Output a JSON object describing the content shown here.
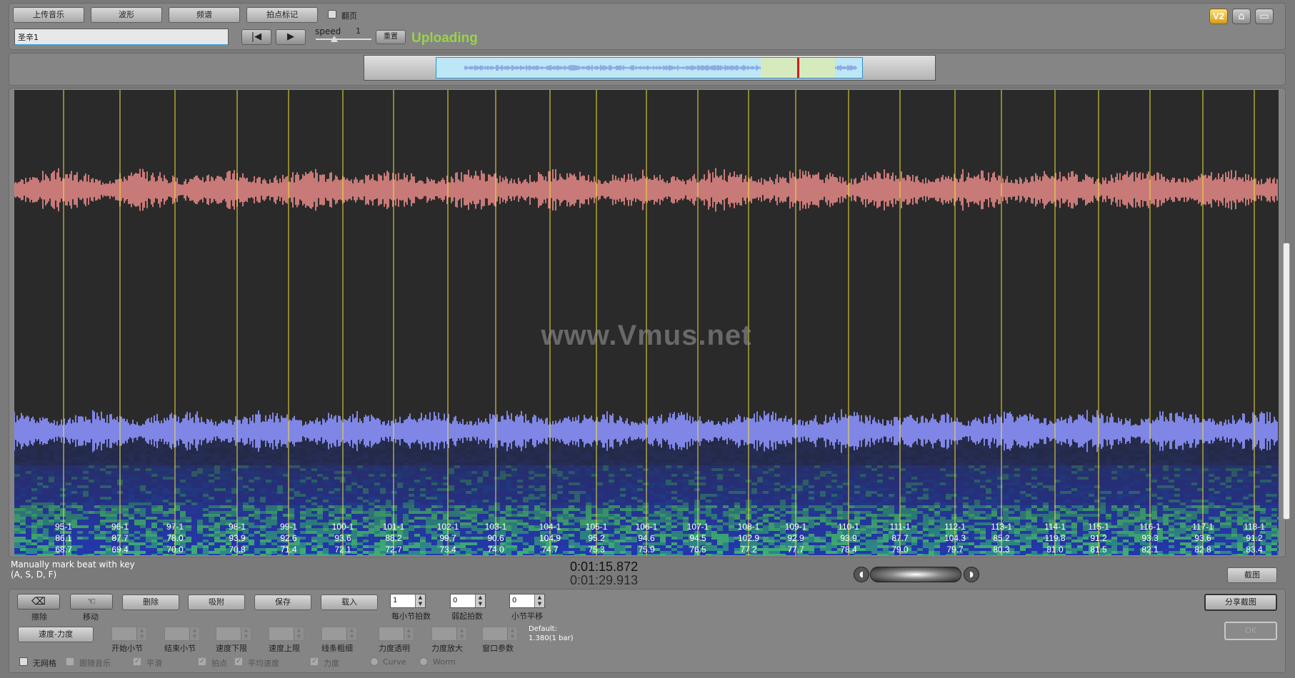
{
  "toolbar": {
    "upload_music": "上传音乐",
    "waveform": "波形",
    "spectrum": "频谱",
    "beat_mark": "拍点标记",
    "flip_page": "翻页",
    "song_name": "圣辛1",
    "speed_label": "speed",
    "speed_value": "1",
    "reset": "重置",
    "status": "Uploading"
  },
  "overview": {
    "window_color": "#bde7f7",
    "selection_color": "#d6ebbd",
    "cursor_color": "#d21a1a"
  },
  "display": {
    "watermark": "www.Vmus.net",
    "wave_top_color": "#c87a78",
    "wave_bottom_color": "#7f86e6",
    "beat_line_color": "#f3e23a",
    "beats": [
      {
        "bar": "95-1",
        "tempo": "86.1",
        "t": "68.7"
      },
      {
        "bar": "96-1",
        "tempo": "87.7",
        "t": "69.4"
      },
      {
        "bar": "97-1",
        "tempo": "78.0",
        "t": "70.0"
      },
      {
        "bar": "98-1",
        "tempo": "93.9",
        "t": "70.8"
      },
      {
        "bar": "99-1",
        "tempo": "92.6",
        "t": "71.4"
      },
      {
        "bar": "100-1",
        "tempo": "93.6",
        "t": "72.1"
      },
      {
        "bar": "101-1",
        "tempo": "88.2",
        "t": "72.7"
      },
      {
        "bar": "102-1",
        "tempo": "99.7",
        "t": "73.4"
      },
      {
        "bar": "103-1",
        "tempo": "90.6",
        "t": "74.0"
      },
      {
        "bar": "104-1",
        "tempo": "104.9",
        "t": "74.7"
      },
      {
        "bar": "105-1",
        "tempo": "95.2",
        "t": "75.3"
      },
      {
        "bar": "106-1",
        "tempo": "94.6",
        "t": "75.9"
      },
      {
        "bar": "107-1",
        "tempo": "94.5",
        "t": "76.5"
      },
      {
        "bar": "108-1",
        "tempo": "102.9",
        "t": "77.2"
      },
      {
        "bar": "109-1",
        "tempo": "92.9",
        "t": "77.7"
      },
      {
        "bar": "110-1",
        "tempo": "93.9",
        "t": "78.4"
      },
      {
        "bar": "111-1",
        "tempo": "87.7",
        "t": "79.0"
      },
      {
        "bar": "112-1",
        "tempo": "104.3",
        "t": "79.7"
      },
      {
        "bar": "113-1",
        "tempo": "85.2",
        "t": "80.3"
      },
      {
        "bar": "114-1",
        "tempo": "119.8",
        "t": "81.0"
      },
      {
        "bar": "115-1",
        "tempo": "91.2",
        "t": "81.5"
      },
      {
        "bar": "116-1",
        "tempo": "93.3",
        "t": "82.1"
      },
      {
        "bar": "117-1",
        "tempo": "93.6",
        "t": "82.8"
      },
      {
        "bar": "118-1",
        "tempo": "91.2",
        "t": "83.4"
      }
    ]
  },
  "status_bar": {
    "hint_line1": "Manually mark beat with key",
    "hint_line2": "(A, S, D, F)",
    "current_time": "0:01:15.872",
    "total_time": "0:01:29.913",
    "screenshot": "截图"
  },
  "bottom": {
    "erase": "擦除",
    "move": "移动",
    "delete": "删除",
    "snap": "吸附",
    "save": "保存",
    "load": "载入",
    "beats_per_bar_value": "1",
    "beats_per_bar_label": "每小节拍数",
    "pickup_value": "0",
    "pickup_label": "弱起拍数",
    "bar_shift_value": "0",
    "bar_shift_label": "小节平移",
    "tempo_dynamics": "速度-力度",
    "start_bar": "开始小节",
    "end_bar": "结束小节",
    "tempo_low": "速度下限",
    "tempo_high": "速度上限",
    "line_width": "线条粗细",
    "dyn_transparency": "力度透明",
    "dyn_zoom": "力度放大",
    "window_param": "窗口参数",
    "default_line1": "Default:",
    "default_line2": "1.380(1 bar)",
    "share_screenshot": "分享截图",
    "ok": "OK",
    "no_grid": "无网格",
    "follow_music": "跟随音乐",
    "smooth": "平滑",
    "beat_point": "拍点",
    "avg_tempo": "平均速度",
    "dynamics": "力度",
    "curve": "Curve",
    "worm": "Worm"
  }
}
